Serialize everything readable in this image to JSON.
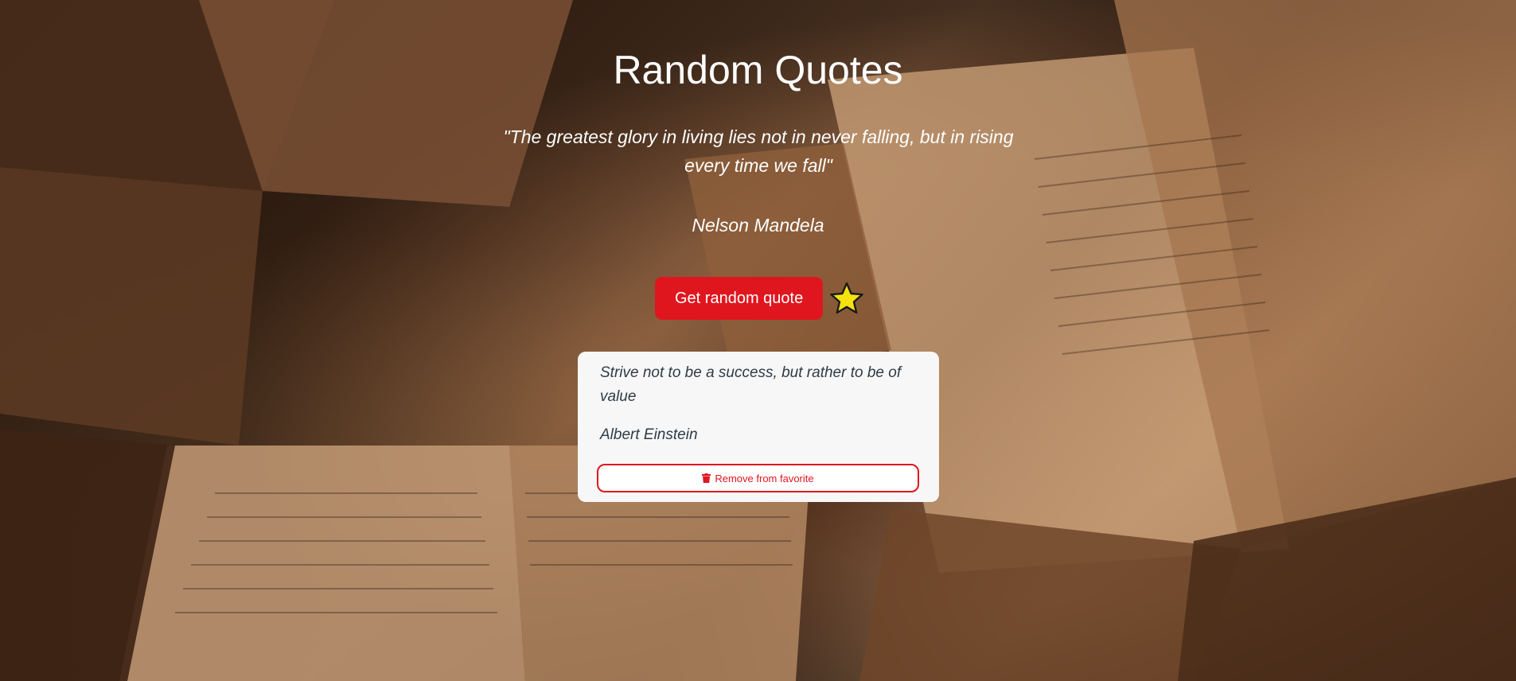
{
  "page": {
    "title": "Random Quotes"
  },
  "current_quote": {
    "text": "\"The greatest glory in living lies not in never falling, but in rising every time we fall\"",
    "author": "Nelson Mandela"
  },
  "actions": {
    "random_label": "Get random quote",
    "favorite_icon": "star-icon"
  },
  "favorites": [
    {
      "text": "Strive not to be a success, but rather to be of value",
      "author": "Albert Einstein",
      "remove_label": "Remove from favorite",
      "remove_icon": "trash-icon"
    }
  ],
  "colors": {
    "accent": "#e0161f",
    "star_fill": "#f5e20f",
    "card_bg": "#f7f7f7",
    "card_text": "#2f3b46"
  }
}
